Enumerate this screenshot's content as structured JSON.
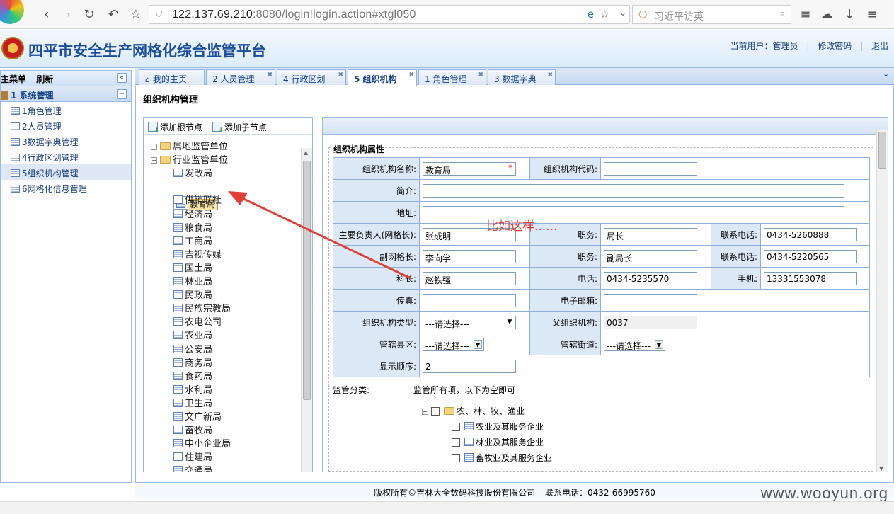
{
  "browser": {
    "url_host": "122.137.69.210",
    "url_rest": ":8080/login!login.action#xtgl050",
    "search_placeholder": "习近平访英"
  },
  "header": {
    "title": "四平市安全生产网格化综合监管平台",
    "current_user_label": "当前用户：",
    "current_user": "管理员",
    "change_password": "修改密码",
    "logout": "退出"
  },
  "sidebar": {
    "menu_label": "主菜单",
    "refresh_label": "刷新",
    "section": "1 系统管理",
    "items": [
      {
        "label": "1角色管理"
      },
      {
        "label": "2人员管理"
      },
      {
        "label": "3数据字典管理"
      },
      {
        "label": "4行政区划管理"
      },
      {
        "label": "5组织机构管理"
      },
      {
        "label": "6网格化信息管理"
      }
    ]
  },
  "tabs": [
    {
      "label": "我的主页"
    },
    {
      "label": "2 人员管理"
    },
    {
      "label": "4 行政区划"
    },
    {
      "label": "5 组织机构"
    },
    {
      "label": "1 角色管理"
    },
    {
      "label": "3 数据字典"
    }
  ],
  "page": {
    "title": "组织机构管理"
  },
  "tree": {
    "add_root": "添加根节点",
    "add_child": "添加子节点",
    "groups": [
      {
        "label": "属地监管单位"
      },
      {
        "label": "行业监管单位"
      }
    ],
    "leaves": [
      "发改局",
      "教育局",
      "供销联社",
      "经济局",
      "粮食局",
      "工商局",
      "吉视传媒",
      "国土局",
      "林业局",
      "民政局",
      "民族宗教局",
      "农电公司",
      "农业局",
      "公安局",
      "商务局",
      "食药局",
      "水利局",
      "卫生局",
      "文广新局",
      "畜牧局",
      "中小企业局",
      "住建局",
      "交通局"
    ]
  },
  "form": {
    "legend": "组织机构属性",
    "org_name_label": "组织机构名称:",
    "org_name": "教育局",
    "org_code_label": "组织机构代码:",
    "org_code": "",
    "intro_label": "简介:",
    "intro": "",
    "address_label": "地址:",
    "address": "",
    "head_label": "主要负责人(网格长):",
    "head": "张成明",
    "duty_label": "职务:",
    "head_duty": "局长",
    "phone_label": "联系电话:",
    "head_phone": "0434-5260888",
    "vice_label": "副网格长:",
    "vice": "李向学",
    "vice_duty": "副局长",
    "vice_phone": "0434-5220565",
    "section_label": "科长:",
    "section_chief": "赵铁强",
    "tel_label": "电话:",
    "section_tel": "0434-5235570",
    "mobile_label": "手机:",
    "section_mobile": "13331553078",
    "fax_label": "传真:",
    "fax": "",
    "email_label": "电子邮箱:",
    "email": "",
    "type_label": "组织机构类型:",
    "type_value": "---请选择---",
    "parent_label": "父组织机构:",
    "parent_value": "0037",
    "county_label": "管辖县区:",
    "county_value": "---请选择---",
    "street_label": "管辖街道:",
    "street_value": "---请选择---",
    "order_label": "显示顺序:",
    "order_value": "2",
    "supervise_label": "监管分类:",
    "supervise_note": "监管所有项，以下为空即可",
    "categories": [
      "农、林、牧、渔业",
      "农业及其服务企业",
      "林业及其服务企业",
      "畜牧业及其服务企业"
    ]
  },
  "annotation": "比如这样......",
  "footer": {
    "copyright": "版权所有©吉林大全数码科技股份有限公司",
    "contact": "联系电话：0432-66995760"
  },
  "watermark": "www.wooyun.org",
  "colors": {
    "accent": "#1a4c9c",
    "annotation": "#e0403a"
  }
}
